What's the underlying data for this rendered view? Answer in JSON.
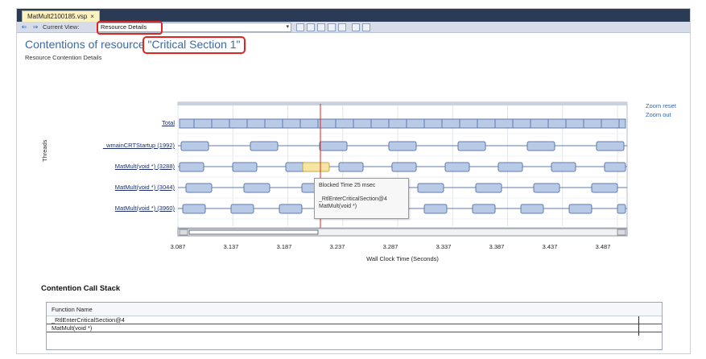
{
  "tab": {
    "title": "MatMult2100185.vsp",
    "close": "×"
  },
  "toolbar": {
    "back_icon": "back-arrow-icon",
    "forward_icon": "forward-arrow-icon",
    "current_view_label": "Current View:",
    "current_view_value": "Resource Details"
  },
  "header": {
    "title_prefix": "Contentions of resource ",
    "resource_name": "\"Critical Section 1\"",
    "subtitle": "Resource Contention Details"
  },
  "chart": {
    "y_label": "Threads",
    "thread_labels": [
      "Total",
      "_wmainCRTStartup (1992)",
      "MatMult(void *) (3288)",
      "MatMult(void *) (3044)",
      "MatMult(void *) (3960)"
    ],
    "x_ticks": [
      "3.087",
      "3.137",
      "3.187",
      "3.237",
      "3.287",
      "3.337",
      "3.387",
      "3.437",
      "3.487"
    ],
    "x_axis_label": "Wall Clock Time (Seconds)",
    "zoom_reset": "Zoom reset",
    "zoom_out": "Zoom out",
    "tooltip": {
      "line1": "Blocked Time 25 msec",
      "line2": "_RtlEnterCriticalSection@4",
      "line3": "MatMult(void *)"
    },
    "colors": {
      "bar": "#b8cae6",
      "bar_border": "#5f7ca8",
      "highlight": "#f6e6a4",
      "marker": "#e0241f"
    }
  },
  "call_stack": {
    "title": "Contention Call Stack",
    "column_header": "Function Name",
    "rows": [
      "_RtlEnterCriticalSection@4",
      "MatMult(void *)"
    ]
  }
}
